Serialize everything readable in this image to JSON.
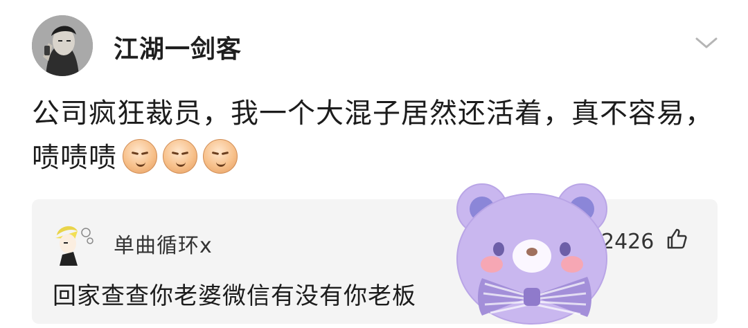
{
  "post": {
    "author": "江湖一剑客",
    "text": "公司疯狂裁员，我一个大混子居然还活着，真不容易，啧啧啧",
    "emoji_icons": [
      "smug-face-emoji-icon",
      "smug-face-emoji-icon",
      "smug-face-emoji-icon"
    ]
  },
  "comment": {
    "author": "单曲循环x",
    "likes": "2426",
    "text": "回家查查你老婆微信有没有你老板"
  },
  "colors": {
    "comment_bg": "#f4f4f4",
    "bear_purple": "#c9b7ef",
    "bear_ear": "#8b86d8",
    "bear_cheek": "#f6a7b4"
  }
}
